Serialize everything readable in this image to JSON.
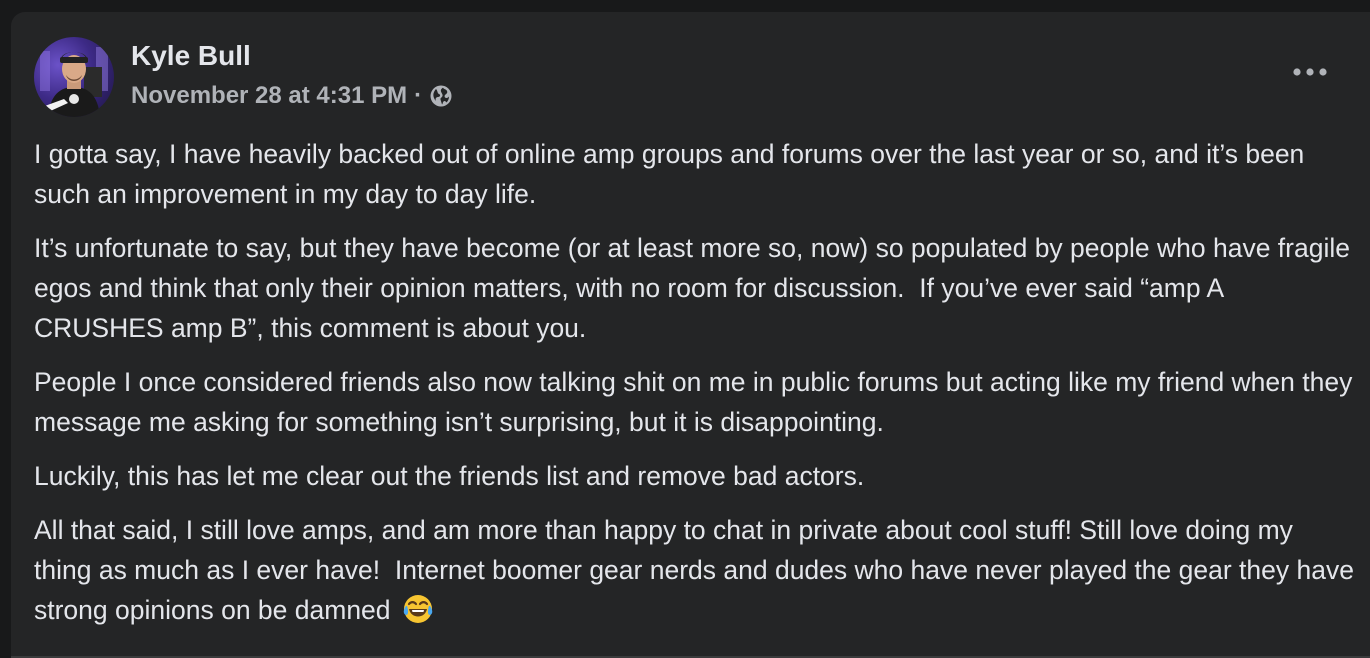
{
  "post": {
    "author": "Kyle Bull",
    "timestamp": "November 28 at 4:31 PM",
    "separator": "·",
    "privacy_icon": "globe-icon",
    "more_icon": "more-options-icon",
    "paragraphs": [
      "I gotta say, I have heavily backed out of online amp groups and forums over the last year or so, and it’s been such an improvement in my day to day life.",
      "It’s unfortunate to say, but they have become (or at least more so, now) so populated by people who have fragile egos and think that only their opinion matters, with no room for discussion.  If you’ve ever said “amp A CRUSHES amp B”, this comment is about you.",
      "People I once considered friends also now talking shit on me in public forums but acting like my friend when they message me asking for something isn’t surprising, but it is disappointing.",
      "Luckily, this has let me clear out the friends list and remove bad actors.",
      "All that said, I still love amps, and am more than happy to chat in private about cool stuff! Still love doing my thing as much as I ever have!  Internet boomer gear nerds and dudes who have never played the gear they have strong opinions on be damned"
    ],
    "trailing_emoji": "tears-of-joy-emoji"
  },
  "colors": {
    "page_bg": "#18191a",
    "card_bg": "#242526",
    "primary_text": "#e4e6eb",
    "secondary_text": "#b0b3b8"
  }
}
